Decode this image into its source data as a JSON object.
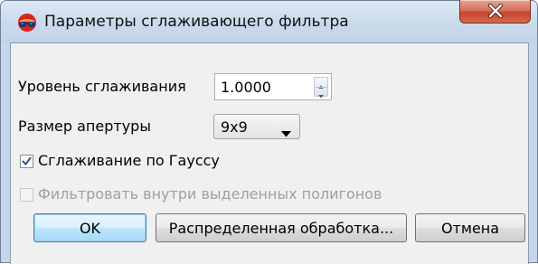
{
  "window": {
    "title": "Параметры сглаживающего фильтра",
    "app_icon": "sunglasses-icon",
    "close_icon": "close-icon"
  },
  "form": {
    "smoothing_level_label": "Уровень сглаживания",
    "smoothing_level_value": "1.0000",
    "aperture_size_label": "Размер апертуры",
    "aperture_size_value": "9x9",
    "gauss_label": "Сглаживание по Гауссу",
    "gauss_checked": true,
    "polygon_filter_label": "Фильтровать внутри выделенных полигонов",
    "polygon_filter_checked": false,
    "polygon_filter_enabled": false
  },
  "buttons": {
    "ok": "OK",
    "distributed": "Распределенная обработка...",
    "cancel": "Отмена"
  },
  "colors": {
    "close_button": "#c4452e",
    "default_button_border": "#3c7fb1",
    "title_bar": "#cddcec"
  }
}
